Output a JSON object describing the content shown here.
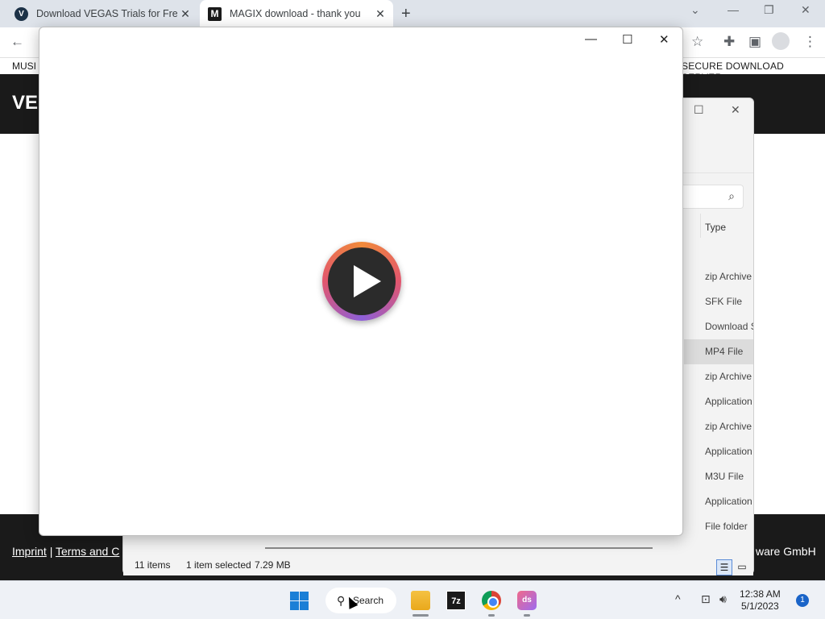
{
  "browser": {
    "tabs": [
      {
        "favicon": "V",
        "title": "Download VEGAS Trials for Free |"
      },
      {
        "favicon": "M",
        "title": "MAGIX download - thank you"
      }
    ],
    "new_tab": "+",
    "window_controls": [
      "⌄",
      "—",
      "❐",
      "✕"
    ]
  },
  "site": {
    "nav_left": "MUSI",
    "nav_right": "SECURE DOWNLOAD SERVER",
    "brand": "VE",
    "footer_links": [
      "Imprint",
      "|",
      "Terms and C"
    ],
    "footer_right": "ware GmbH"
  },
  "explorer": {
    "column_header": "Type",
    "rows": [
      {
        "type": "zip Archive",
        "selected": false
      },
      {
        "type": "SFK File",
        "selected": false
      },
      {
        "type": "Download S",
        "selected": false
      },
      {
        "type": "MP4 File",
        "selected": true
      },
      {
        "type": "zip Archive",
        "selected": false
      },
      {
        "type": "Application",
        "selected": false
      },
      {
        "type": "zip Archive",
        "selected": false
      },
      {
        "type": "Application",
        "selected": false
      },
      {
        "type": "M3U File",
        "selected": false
      },
      {
        "type": "Application",
        "selected": false
      },
      {
        "type": "File folder",
        "selected": false
      }
    ],
    "status": {
      "items": "11 items",
      "selected": "1 item selected",
      "size": "7.29 MB"
    }
  },
  "player": {
    "controls": [
      "—",
      "☐",
      "✕"
    ],
    "play_button_colors": [
      "#f08a3a",
      "#e2566d",
      "#8d5fd8"
    ]
  },
  "taskbar": {
    "search_label": "Search",
    "apps": [
      "file-explorer",
      "7-zip",
      "chrome",
      "ds-app"
    ],
    "sevenz_label": "7z",
    "ds_label": "ds",
    "clock_time": "12:38 AM",
    "clock_date": "5/1/2023",
    "notification_count": "1"
  }
}
